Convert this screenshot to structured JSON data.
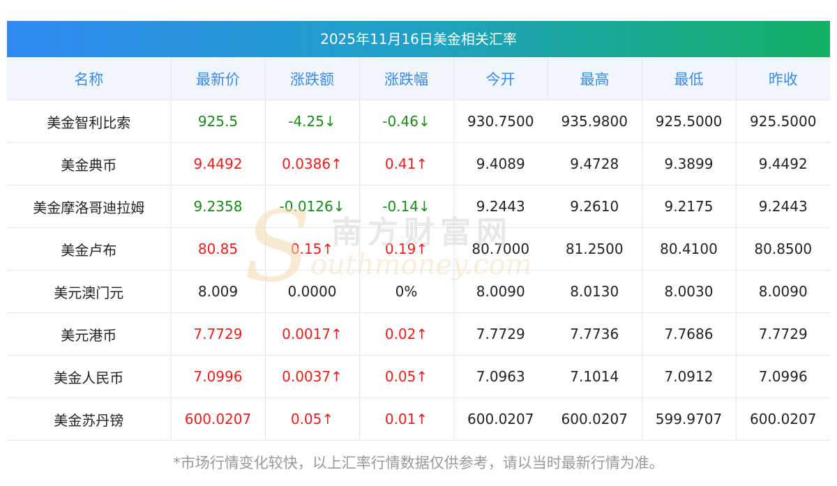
{
  "title": "2025年11月16日美金相关汇率",
  "headers": [
    "名称",
    "最新价",
    "涨跌额",
    "涨跌幅",
    "今开",
    "最高",
    "最低",
    "昨收"
  ],
  "rows": [
    {
      "name": "美金智利比索",
      "last": "925.5",
      "change": "-4.25↓",
      "pct": "-0.46↓",
      "open": "930.7500",
      "high": "935.9800",
      "low": "925.5000",
      "prev": "925.5000",
      "dir": "down"
    },
    {
      "name": "美金典币",
      "last": "9.4492",
      "change": "0.0386↑",
      "pct": "0.41↑",
      "open": "9.4089",
      "high": "9.4728",
      "low": "9.3899",
      "prev": "9.4492",
      "dir": "up"
    },
    {
      "name": "美金摩洛哥迪拉姆",
      "last": "9.2358",
      "change": "-0.0126↓",
      "pct": "-0.14↓",
      "open": "9.2443",
      "high": "9.2610",
      "low": "9.2175",
      "prev": "9.2443",
      "dir": "down"
    },
    {
      "name": "美金卢布",
      "last": "80.85",
      "change": "0.15↑",
      "pct": "0.19↑",
      "open": "80.7000",
      "high": "81.2500",
      "low": "80.4100",
      "prev": "80.8500",
      "dir": "up"
    },
    {
      "name": "美元澳门元",
      "last": "8.009",
      "change": "0.0000",
      "pct": "0%",
      "open": "8.0090",
      "high": "8.0130",
      "low": "8.0030",
      "prev": "8.0090",
      "dir": "flat"
    },
    {
      "name": "美元港币",
      "last": "7.7729",
      "change": "0.0017↑",
      "pct": "0.02↑",
      "open": "7.7729",
      "high": "7.7736",
      "low": "7.7686",
      "prev": "7.7729",
      "dir": "up"
    },
    {
      "name": "美金人民币",
      "last": "7.0996",
      "change": "0.0037↑",
      "pct": "0.05↑",
      "open": "7.0963",
      "high": "7.1014",
      "low": "7.0912",
      "prev": "7.0996",
      "dir": "up"
    },
    {
      "name": "美金苏丹镑",
      "last": "600.0207",
      "change": "0.05↑",
      "pct": "0.01↑",
      "open": "600.0207",
      "high": "600.0207",
      "low": "599.9707",
      "prev": "600.0207",
      "dir": "up"
    }
  ],
  "note": "*市场行情变化较快，以上汇率行情数据仅供参考，请以当时最新行情为准。",
  "watermark": {
    "chinese": "南方财富网",
    "english": "outhmoney.com",
    "initial": "S"
  },
  "colors": {
    "up": "#ef1c1c",
    "down": "#1a8a1a",
    "header_text": "#3a8be8",
    "title_gradient_start": "#2f8af2",
    "title_gradient_end": "#13b063"
  }
}
